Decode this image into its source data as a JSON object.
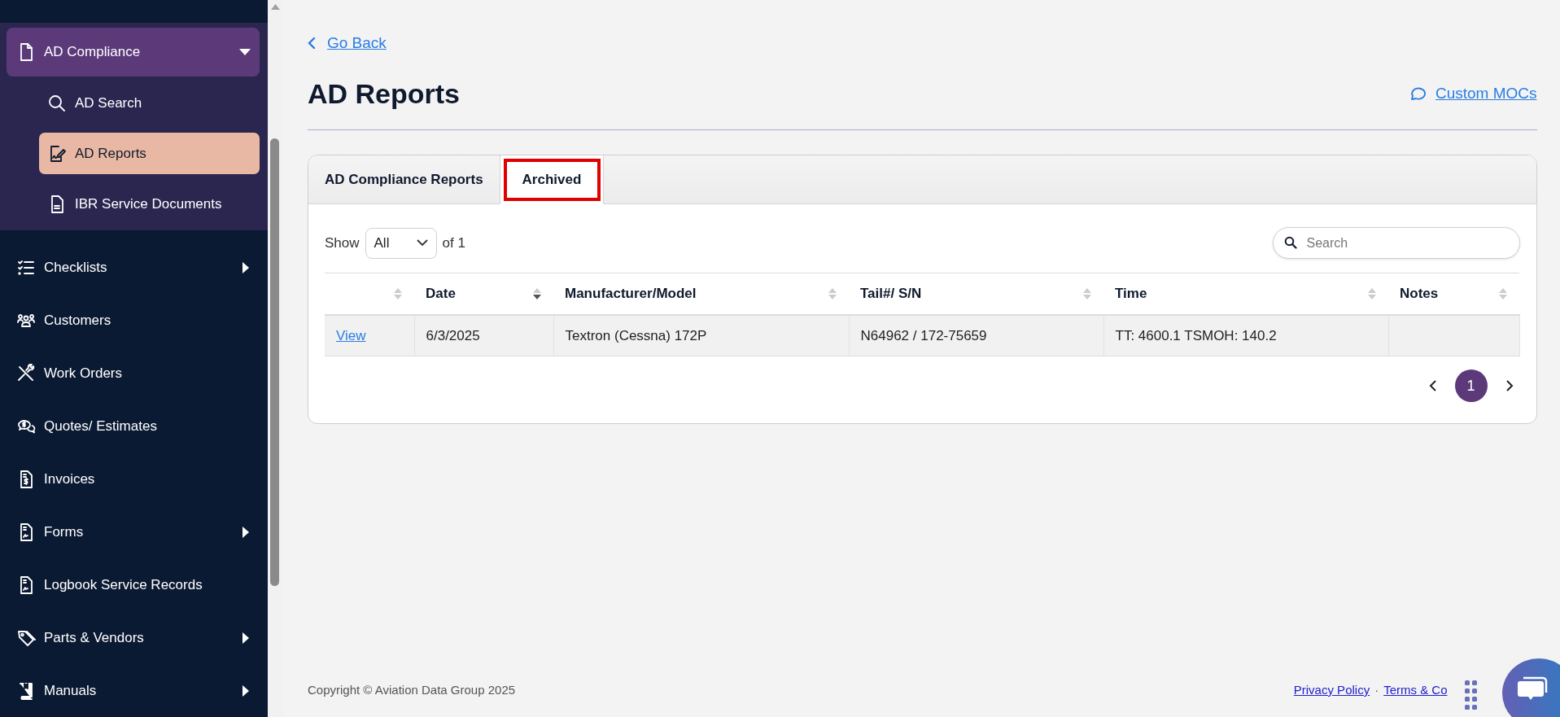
{
  "sidebar": {
    "items": [
      {
        "label": "AD Compliance",
        "selected": false,
        "expanded": true,
        "children": [
          {
            "label": "AD Search",
            "selected": false
          },
          {
            "label": "AD Reports",
            "selected": true
          },
          {
            "label": "IBR Service Documents",
            "selected": false
          }
        ]
      },
      {
        "label": "Checklists",
        "selected": false,
        "expanded": false
      },
      {
        "label": "Customers",
        "selected": false
      },
      {
        "label": "Work Orders",
        "selected": false
      },
      {
        "label": "Quotes/ Estimates",
        "selected": false
      },
      {
        "label": "Invoices",
        "selected": false
      },
      {
        "label": "Forms",
        "selected": false,
        "expanded": false
      },
      {
        "label": "Logbook Service Records",
        "selected": false
      },
      {
        "label": "Parts & Vendors",
        "selected": false,
        "expanded": false
      },
      {
        "label": "Manuals",
        "selected": false,
        "expanded": false
      }
    ]
  },
  "back_link": "Go Back",
  "title": "AD Reports",
  "custom_mocs_link": "Custom MOCs",
  "tabs": [
    {
      "label": "AD Compliance Reports",
      "selected": false,
      "outlined": false
    },
    {
      "label": "Archived",
      "selected": true,
      "outlined": true
    }
  ],
  "show": {
    "label": "Show",
    "value": "All",
    "suffix": "of 1"
  },
  "search": {
    "placeholder": "Search"
  },
  "table": {
    "columns": [
      {
        "sorted_desc": false
      },
      {
        "label": "Date",
        "sorted_desc": true
      },
      {
        "label": "Manufacturer/Model",
        "sorted_desc": false
      },
      {
        "label": "Tail#/ S/N",
        "sorted_desc": false
      },
      {
        "label": "Time",
        "sorted_desc": false
      },
      {
        "label": "Notes",
        "sorted_desc": false
      }
    ],
    "rows": [
      {
        "cells": [
          {
            "kind": "link",
            "text": "View"
          },
          {
            "kind": "text",
            "text": "6/3/2025"
          },
          {
            "kind": "text",
            "text": "Textron (Cessna) 172P"
          },
          {
            "kind": "text",
            "text": "N64962 / 172-75659"
          },
          {
            "kind": "text",
            "text": "TT: 4600.1 TSMOH: 140.2"
          }
        ]
      }
    ]
  },
  "pagination": {
    "pages": [
      {
        "label": "1",
        "selected": true
      }
    ]
  },
  "footer": {
    "copyright": "Copyright © Aviation Data Group 2025",
    "links": [
      "Privacy Policy",
      "Terms & Co"
    ],
    "separator": "·"
  }
}
